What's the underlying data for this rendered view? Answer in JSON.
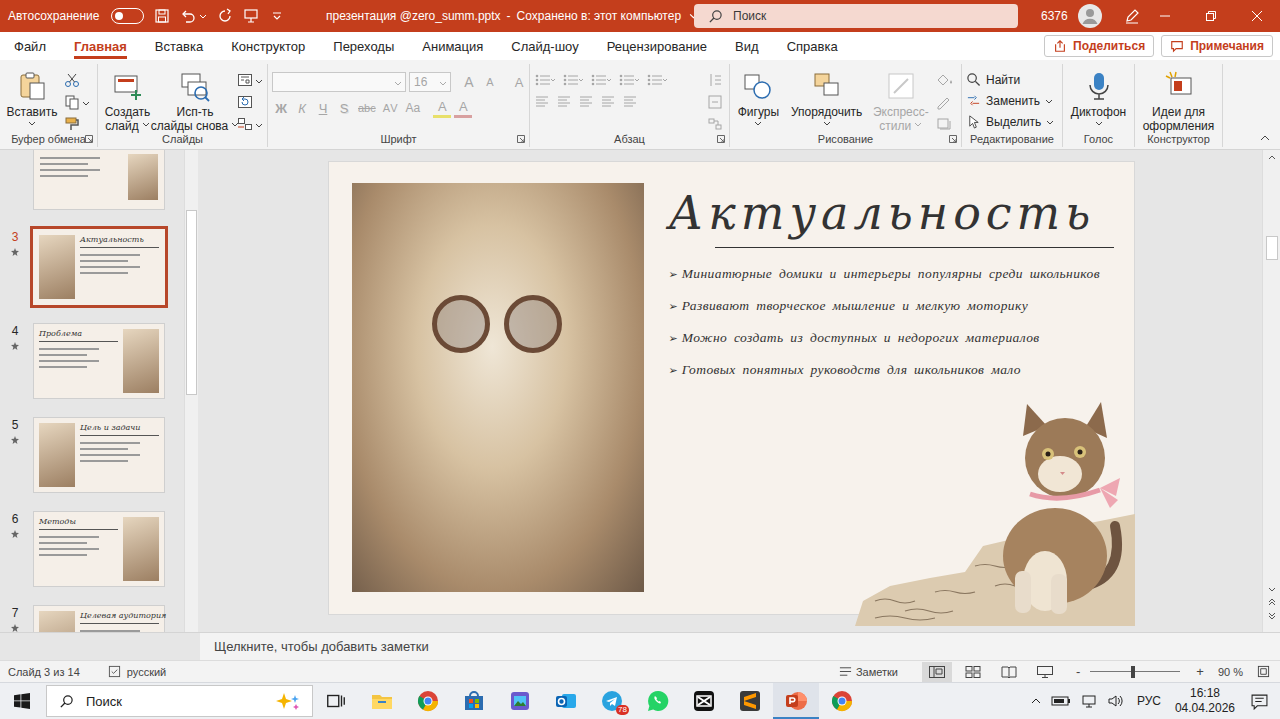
{
  "window": {
    "autosave_label": "Автосохранение",
    "autosave_on": false,
    "document": "презентация @zero_summ.pptx",
    "separator": "-",
    "saved": "Сохранено в: этот компьютер",
    "search_placeholder": "Поиск",
    "counter": "6376"
  },
  "tabs": [
    {
      "label": "Файл",
      "selected": false
    },
    {
      "label": "Главная",
      "selected": true
    },
    {
      "label": "Вставка",
      "selected": false
    },
    {
      "label": "Конструктор",
      "selected": false
    },
    {
      "label": "Переходы",
      "selected": false
    },
    {
      "label": "Анимация",
      "selected": false
    },
    {
      "label": "Слайд-шоу",
      "selected": false
    },
    {
      "label": "Рецензирование",
      "selected": false
    },
    {
      "label": "Вид",
      "selected": false
    },
    {
      "label": "Справка",
      "selected": false
    }
  ],
  "share": "Поделиться",
  "comments": "Примечания",
  "ribbon": {
    "clipboard": {
      "label": "Буфер обмена",
      "paste": "Вставить"
    },
    "slides": {
      "label": "Слайды",
      "new_slide": [
        "Создать",
        "слайд"
      ],
      "reuse": [
        "Исп-ть",
        "слайды снова"
      ]
    },
    "font": {
      "label": "Шрифт",
      "disabled": true,
      "size": "16",
      "row1_buttons": [
        "A",
        "A",
        "A"
      ],
      "row2_buttons": [
        "Ж",
        "К",
        "Ч",
        "S",
        "abc",
        "AV",
        "Aa",
        "A",
        "A"
      ]
    },
    "paragraph": {
      "label": "Абзац",
      "disabled": true
    },
    "drawing": {
      "label": "Рисование",
      "shapes": "Фигуры",
      "arrange": "Упорядочить",
      "quick_styles": [
        "Экспресс-",
        "стили"
      ],
      "quick_styles_disabled": true
    },
    "editing": {
      "label": "Редактирование",
      "find": "Найти",
      "replace": "Заменить",
      "select": "Выделить"
    },
    "voice": {
      "label": "Голос",
      "dictate": "Диктофон"
    },
    "designer": {
      "label": "Конструктор",
      "ideas": [
        "Идеи для",
        "оформления"
      ]
    }
  },
  "thumbnails": [
    {
      "number": "3",
      "title": "Актуальность",
      "selected": true,
      "animated": true
    },
    {
      "number": "4",
      "title": "Проблема",
      "selected": false,
      "animated": true
    },
    {
      "number": "5",
      "title": "Цель и задачи",
      "selected": false,
      "animated": true
    },
    {
      "number": "6",
      "title": "Методы",
      "selected": false,
      "animated": true
    },
    {
      "number": "7",
      "title": "Целевая аудитория",
      "selected": false,
      "animated": true
    }
  ],
  "slide": {
    "title": "Актуальность",
    "bullet": "➢",
    "bullets": [
      "Миниатюрные домики и интерьеры популярны среди школьников",
      "Развивают творческое мышление и мелкую моторику",
      "Можно создать из доступных и недорогих материалов",
      "Готовых понятных руководств для школьников мало"
    ]
  },
  "notes_placeholder": "Щелкните, чтобы добавить заметки",
  "status": {
    "slide": "Слайд 3 из 14",
    "language": "русский",
    "notes": "Заметки",
    "views": [
      {
        "kind": "normal",
        "selected": true
      },
      {
        "kind": "sorter",
        "selected": false
      },
      {
        "kind": "reading",
        "selected": false
      },
      {
        "kind": "slideshow",
        "selected": false
      }
    ],
    "zoom_minus": "-",
    "zoom_plus": "+",
    "zoom_level": 0.47,
    "zoom": "90 %"
  },
  "taskbar": {
    "search": "Поиск",
    "apps": [
      {
        "kind": "taskview",
        "active": false
      },
      {
        "kind": "explorer",
        "active": false
      },
      {
        "kind": "chrome",
        "active": false
      },
      {
        "kind": "store",
        "active": false
      },
      {
        "kind": "photos",
        "active": false
      },
      {
        "kind": "outlook",
        "active": false
      },
      {
        "kind": "telegram",
        "active": false,
        "badge": "78"
      },
      {
        "kind": "whatsapp",
        "active": false
      },
      {
        "kind": "capcut",
        "active": false
      },
      {
        "kind": "sublime",
        "active": false
      },
      {
        "kind": "powerpoint",
        "active": true
      },
      {
        "kind": "chrome",
        "active": false
      }
    ],
    "language": "РУС",
    "time": "16:18",
    "date": "04.04.2026"
  }
}
